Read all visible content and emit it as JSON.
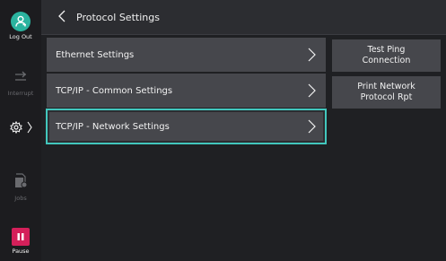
{
  "rail": {
    "logout_label": "Log Out",
    "interrupt_label": "Interrupt",
    "jobs_label": "Jobs",
    "pause_label": "Pause"
  },
  "header": {
    "title": "Protocol Settings"
  },
  "list": {
    "items": [
      {
        "label": "Ethernet Settings"
      },
      {
        "label": "TCP/IP - Common Settings"
      },
      {
        "label": "TCP/IP - Network Settings"
      }
    ]
  },
  "side_buttons": {
    "test_ping": "Test Ping\nConnection",
    "print_network": "Print Network\nProtocol Rpt"
  },
  "colors": {
    "accent": "#42c7bd",
    "logout_badge": "#2bb39f",
    "pause_badge": "#d4205a",
    "panel": "#46474c"
  },
  "icons": {
    "logout": "user-logout-icon",
    "interrupt": "interrupt-icon",
    "settings": "gear-icon",
    "jobs": "jobs-icon",
    "pause": "pause-icon",
    "back": "chevron-left-icon",
    "row": "chevron-right-icon"
  }
}
